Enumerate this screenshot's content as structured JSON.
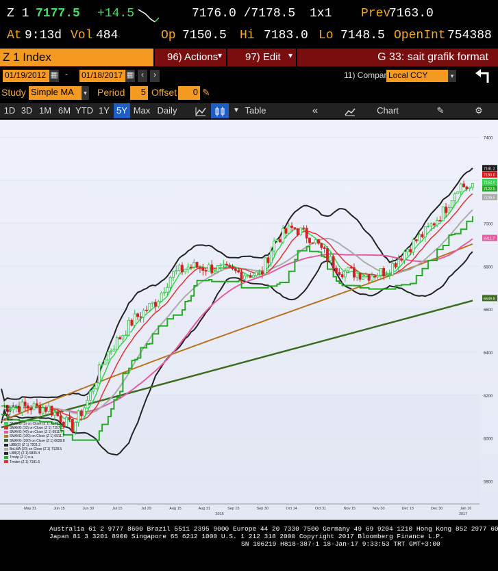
{
  "quote": {
    "ticker": "Z 1",
    "last": "7177.5",
    "change": "+14.5",
    "bid_ask": "7176.0 /7178.5",
    "size": "1x1",
    "prev_label": "Prev",
    "prev": "7163.0",
    "at_label": "At",
    "at_time": "9:13d",
    "vol_label": "Vol",
    "vol": "484",
    "op_label": "Op",
    "op": "7150.5",
    "hi_label": "Hi",
    "hi": "7183.0",
    "lo_label": "Lo",
    "lo": "7148.5",
    "oi_label": "OpenInt",
    "oi": "754388"
  },
  "cmdbar": {
    "security": "Z 1 Index",
    "actions": "96) Actions",
    "edit": "97) Edit",
    "title": "G 33: sait grafik format"
  },
  "range": {
    "start": "01/19/2012",
    "end": "01/18/2017",
    "compare_label": "11) Compare",
    "compare_value": "Local CCY"
  },
  "study": {
    "study_label": "Study",
    "study_value": "Simple MA",
    "period_label": "Period",
    "period_value": "5",
    "offset_label": "Offset",
    "offset_value": "0"
  },
  "toolbar": {
    "periods": [
      "1D",
      "3D",
      "1M",
      "6M",
      "YTD",
      "1Y",
      "5Y",
      "Max"
    ],
    "active_period": "5Y",
    "freq": "Daily",
    "table": "Table",
    "chart_content": "Chart Content"
  },
  "chart_data": {
    "type": "line",
    "x_ticks": [
      "May 31",
      "Jun 15",
      "Jun 30",
      "Jul 15",
      "Jul 29",
      "Aug 15",
      "Aug 31",
      "Sep 15",
      "Sep 30",
      "Oct 14",
      "Oct 31",
      "Nov 15",
      "Nov 30",
      "Dec 15",
      "Dec 30",
      "Jan 16"
    ],
    "year_labels": [
      "2016",
      "2017"
    ],
    "y_ticks": [
      5800,
      6000,
      6200,
      6400,
      6600,
      6800,
      7000,
      7200,
      7400
    ],
    "ylim": [
      5700,
      7450
    ],
    "right_tags": [
      {
        "text": "7181.2",
        "color": "#1a1a1a"
      },
      {
        "text": "7180.0",
        "color": "#d11"
      },
      {
        "text": "7152.0",
        "color": "#33d44a"
      },
      {
        "text": "7122.5",
        "color": "#2a2"
      },
      {
        "text": "7108.5",
        "color": "#aaaaaa"
      },
      {
        "text": "6911.7",
        "color": "#e65aa0"
      },
      {
        "text": "6639.8",
        "color": "#3a6b1e"
      }
    ],
    "series": [
      {
        "name": "SMAVG (5) on Close (Z 1)",
        "color": "#33d44a",
        "value": "7177.8"
      },
      {
        "name": "SMAVG (10) on Close (Z 1)",
        "color": "#e23030",
        "value": "7157.1"
      },
      {
        "name": "SMAVG (40) on Close (Z 1)",
        "color": "#e65aa0",
        "value": "6911.7"
      },
      {
        "name": "SMAVG (100) on Close (Z 1)",
        "color": "#b8731e",
        "value": "6911.7"
      },
      {
        "name": "SMAVG (200) on Close (Z 1)",
        "color": "#3a6b1e",
        "value": "6639.8"
      },
      {
        "name": "UBB(2) (Z 1)",
        "color": "#222222",
        "value": "7201.2"
      },
      {
        "name": "BoLMA (20) on Close (Z 1)",
        "color": "#aaaaaa",
        "value": "7128.5"
      },
      {
        "name": "LBB(2) (Z 1)",
        "color": "#222222",
        "value": "6835.4"
      },
      {
        "name": "Tmstp (Z 1)",
        "color": "#33aa33",
        "value": "n.a."
      },
      {
        "name": "Tmstrn (Z 1)",
        "color": "#e23030",
        "value": "7181.6"
      }
    ]
  },
  "legend": {
    "header_lines": [
      "Last Price",
      "High",
      "Low",
      "Close"
    ]
  },
  "footer": {
    "line1": "Australia 61 2 9777 8600 Brazil 5511 2395 9000 Europe 44 20 7330 7500 Germany 49 69 9204 1210 Hong Kong 852 2977 6000",
    "line2": "Japan 81 3 3201 8900      Singapore 65 6212 1000      U.S. 1 212 318 2000          Copyright 2017 Bloomberg Finance L.P.",
    "line3": "SN 106219 H818-387-1 18-Jan-17  9:33:53 TRT  GMT+3:00"
  }
}
